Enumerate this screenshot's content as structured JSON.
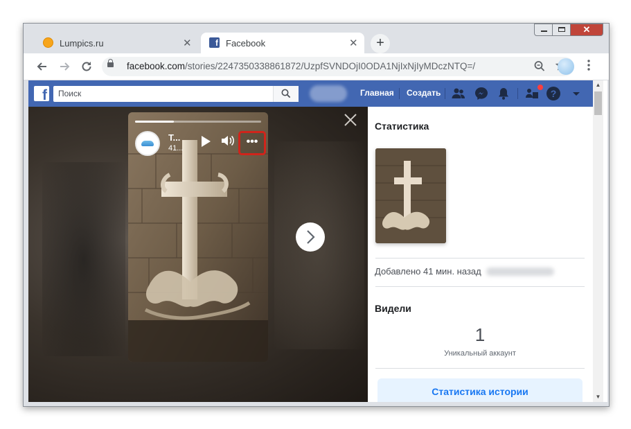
{
  "tabs": [
    {
      "title": "Lumpics.ru",
      "icon": "lumpics-favicon-icon",
      "active": false
    },
    {
      "title": "Facebook",
      "icon": "facebook-favicon-icon",
      "active": true
    }
  ],
  "tab_close_glyph": "✕",
  "new_tab_glyph": "+",
  "window_controls": {
    "close_glyph": "✕"
  },
  "address_bar": {
    "host": "facebook.com",
    "path": "/stories/2247350338861872/UzpfSVNDOjI0ODA1NjIxNjIyMDczNTQ=/"
  },
  "facebook": {
    "search_placeholder": "Поиск",
    "nav": {
      "home": "Главная",
      "create": "Создать"
    },
    "icons": [
      "friends-icon",
      "messenger-icon",
      "notifications-icon",
      "quick-help-icon",
      "help-icon",
      "account-menu-icon"
    ]
  },
  "story": {
    "author_initial": "T...",
    "time": "41...",
    "progress": 0.31,
    "more_glyph": "•••"
  },
  "panel": {
    "title": "Статистика",
    "added": "Добавлено 41 мин. назад",
    "viewers_title": "Видели",
    "viewers_count": "1",
    "viewers_label": "Уникальный аккаунт",
    "stats_button": "Статистика истории"
  },
  "colors": {
    "facebook_blue": "#4267b2",
    "highlight_red": "#d0241b",
    "button_text": "#1877f2"
  }
}
